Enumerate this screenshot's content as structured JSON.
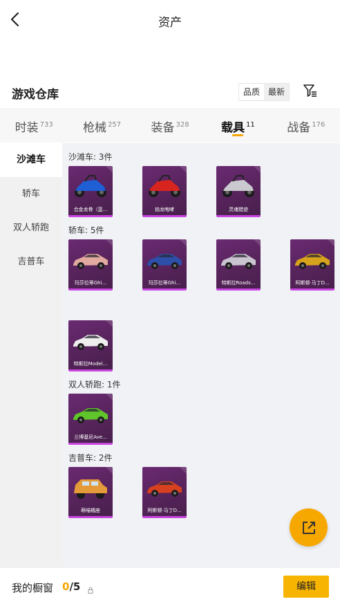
{
  "header": {
    "title": "资产"
  },
  "warehouse": {
    "title": "游戏仓库",
    "sort_options": [
      "品质",
      "最新"
    ]
  },
  "tabs": [
    {
      "label": "时装",
      "count": "733",
      "active": false
    },
    {
      "label": "枪械",
      "count": "257",
      "active": false
    },
    {
      "label": "装备",
      "count": "328",
      "active": false
    },
    {
      "label": "载具",
      "count": "11",
      "active": true
    },
    {
      "label": "战备",
      "count": "176",
      "active": false
    }
  ],
  "sidebar": {
    "items": [
      {
        "label": "沙滩车",
        "active": true
      },
      {
        "label": "轿车",
        "active": false
      },
      {
        "label": "双人轿跑",
        "active": false
      },
      {
        "label": "吉普车",
        "active": false
      }
    ]
  },
  "sections": [
    {
      "label": "沙滩车: 3件",
      "items": [
        {
          "name": "合金龙骨（蓝...",
          "color": "#1f5fd6",
          "kind": "buggy"
        },
        {
          "name": "焰龙咆哮",
          "color": "#d8241f",
          "kind": "buggy"
        },
        {
          "name": "灵魂猎迹",
          "color": "#c9c9cf",
          "kind": "buggy"
        }
      ]
    },
    {
      "label": "轿车: 5件",
      "items": [
        {
          "name": "玛莎拉蒂Ghi...",
          "color": "#e2a9a0",
          "kind": "car"
        },
        {
          "name": "玛莎拉蒂Ghi...",
          "color": "#2d4fa8",
          "kind": "car"
        },
        {
          "name": "特斯拉Roads...",
          "color": "#c9c4cf",
          "kind": "car"
        },
        {
          "name": "阿斯顿·马丁D...",
          "color": "#d7a21c",
          "kind": "car"
        },
        {
          "name": "特斯拉Model...",
          "color": "#eeeeee",
          "kind": "car"
        }
      ]
    },
    {
      "label": "双人轿跑: 1件",
      "items": [
        {
          "name": "兰博基尼Ave...",
          "color": "#5fc52a",
          "kind": "car"
        }
      ]
    },
    {
      "label": "吉普车: 2件",
      "items": [
        {
          "name": "萌喵橘座",
          "color": "#e59a3a",
          "kind": "jeep"
        },
        {
          "name": "阿斯顿·马丁D...",
          "color": "#d8411f",
          "kind": "car"
        }
      ]
    }
  ],
  "bottom": {
    "showcase_label": "我的橱窗",
    "showcase_used": "0",
    "showcase_total": "/5",
    "edit_label": "编辑"
  },
  "colors": {
    "accent": "#f5a500",
    "card_bg": "#5a2360",
    "card_border": "#c945e0"
  }
}
